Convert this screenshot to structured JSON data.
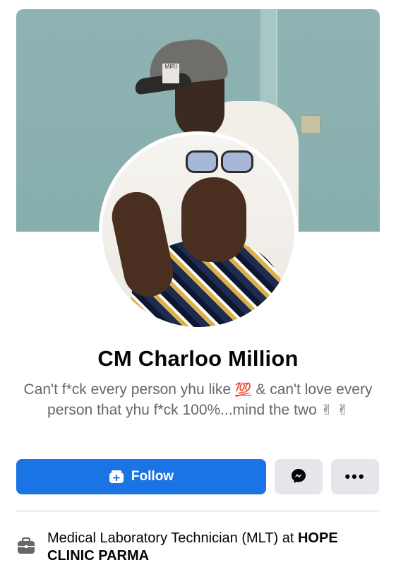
{
  "profile": {
    "name": "CM Charloo Million",
    "bio": {
      "line1_before": "Can't f*ck every person yhu like ",
      "emoji_100": "💯",
      "line1_after": " & can't love every person that yhu f*ck  100%...mind the two ",
      "emoji_victory": "✌",
      "emoji_victory2": "✌"
    },
    "cover_cap_text": "MIRI"
  },
  "actions": {
    "follow_label": "Follow",
    "more_label": "•••"
  },
  "work": {
    "prefix": "Medical Laboratory Technician (MLT) at ",
    "employer": "HOPE CLINIC PARMA"
  },
  "colors": {
    "primary": "#1b74e4",
    "secondary_button": "#e4e6eb",
    "bio_text": "#65676b"
  },
  "icons": {
    "follow": "add-friend-icon",
    "messenger": "messenger-icon",
    "more": "more-dots-icon",
    "work": "briefcase-icon"
  }
}
